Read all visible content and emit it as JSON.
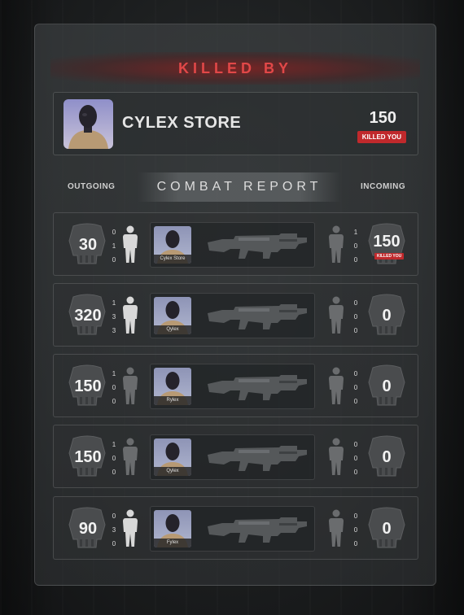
{
  "killed_by": {
    "title": "KILLED BY",
    "killer_name": "CYLEX STORE",
    "damage": "150",
    "badge": "KILLED YOU"
  },
  "combat_report": {
    "title": "COMBAT REPORT",
    "outgoing_label": "OUTGOING",
    "incoming_label": "INCOMING",
    "rows": [
      {
        "outgoing": "30",
        "out_stats": [
          "0",
          "1",
          "0"
        ],
        "player": "Cylex Store",
        "in_stats": [
          "1",
          "0",
          "0"
        ],
        "incoming": "150",
        "incoming_badge": "KILLED YOU"
      },
      {
        "outgoing": "320",
        "out_stats": [
          "1",
          "3",
          "3"
        ],
        "player": "Qylex",
        "in_stats": [
          "0",
          "0",
          "0"
        ],
        "incoming": "0"
      },
      {
        "outgoing": "150",
        "out_stats": [
          "1",
          "0",
          "0"
        ],
        "player": "Rylex",
        "in_stats": [
          "0",
          "0",
          "0"
        ],
        "incoming": "0"
      },
      {
        "outgoing": "150",
        "out_stats": [
          "1",
          "0",
          "0"
        ],
        "player": "Qylex",
        "in_stats": [
          "0",
          "0",
          "0"
        ],
        "incoming": "0"
      },
      {
        "outgoing": "90",
        "out_stats": [
          "0",
          "3",
          "0"
        ],
        "player": "Fylex",
        "in_stats": [
          "0",
          "0",
          "0"
        ],
        "incoming": "0"
      }
    ]
  },
  "colors": {
    "accent_red": "#c0292c",
    "title_red": "#e14848"
  }
}
